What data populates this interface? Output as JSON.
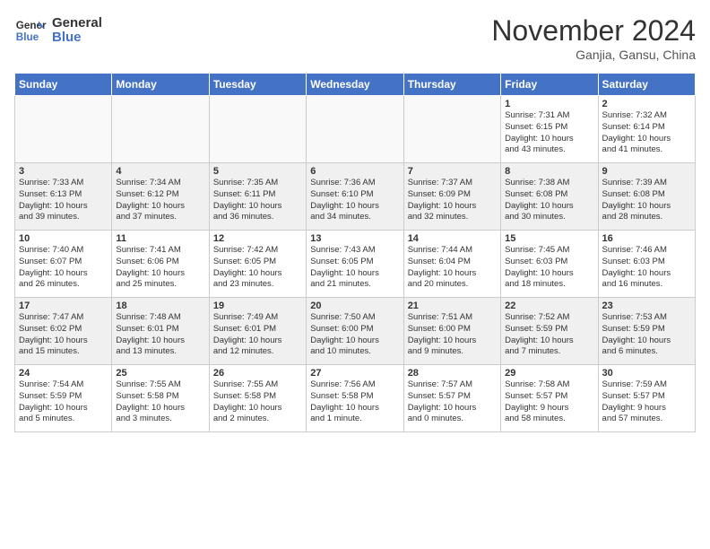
{
  "header": {
    "logo_line1": "General",
    "logo_line2": "Blue",
    "month": "November 2024",
    "location": "Ganjia, Gansu, China"
  },
  "weekdays": [
    "Sunday",
    "Monday",
    "Tuesday",
    "Wednesday",
    "Thursday",
    "Friday",
    "Saturday"
  ],
  "weeks": [
    [
      {
        "day": "",
        "info": ""
      },
      {
        "day": "",
        "info": ""
      },
      {
        "day": "",
        "info": ""
      },
      {
        "day": "",
        "info": ""
      },
      {
        "day": "",
        "info": ""
      },
      {
        "day": "1",
        "info": "Sunrise: 7:31 AM\nSunset: 6:15 PM\nDaylight: 10 hours\nand 43 minutes."
      },
      {
        "day": "2",
        "info": "Sunrise: 7:32 AM\nSunset: 6:14 PM\nDaylight: 10 hours\nand 41 minutes."
      }
    ],
    [
      {
        "day": "3",
        "info": "Sunrise: 7:33 AM\nSunset: 6:13 PM\nDaylight: 10 hours\nand 39 minutes."
      },
      {
        "day": "4",
        "info": "Sunrise: 7:34 AM\nSunset: 6:12 PM\nDaylight: 10 hours\nand 37 minutes."
      },
      {
        "day": "5",
        "info": "Sunrise: 7:35 AM\nSunset: 6:11 PM\nDaylight: 10 hours\nand 36 minutes."
      },
      {
        "day": "6",
        "info": "Sunrise: 7:36 AM\nSunset: 6:10 PM\nDaylight: 10 hours\nand 34 minutes."
      },
      {
        "day": "7",
        "info": "Sunrise: 7:37 AM\nSunset: 6:09 PM\nDaylight: 10 hours\nand 32 minutes."
      },
      {
        "day": "8",
        "info": "Sunrise: 7:38 AM\nSunset: 6:08 PM\nDaylight: 10 hours\nand 30 minutes."
      },
      {
        "day": "9",
        "info": "Sunrise: 7:39 AM\nSunset: 6:08 PM\nDaylight: 10 hours\nand 28 minutes."
      }
    ],
    [
      {
        "day": "10",
        "info": "Sunrise: 7:40 AM\nSunset: 6:07 PM\nDaylight: 10 hours\nand 26 minutes."
      },
      {
        "day": "11",
        "info": "Sunrise: 7:41 AM\nSunset: 6:06 PM\nDaylight: 10 hours\nand 25 minutes."
      },
      {
        "day": "12",
        "info": "Sunrise: 7:42 AM\nSunset: 6:05 PM\nDaylight: 10 hours\nand 23 minutes."
      },
      {
        "day": "13",
        "info": "Sunrise: 7:43 AM\nSunset: 6:05 PM\nDaylight: 10 hours\nand 21 minutes."
      },
      {
        "day": "14",
        "info": "Sunrise: 7:44 AM\nSunset: 6:04 PM\nDaylight: 10 hours\nand 20 minutes."
      },
      {
        "day": "15",
        "info": "Sunrise: 7:45 AM\nSunset: 6:03 PM\nDaylight: 10 hours\nand 18 minutes."
      },
      {
        "day": "16",
        "info": "Sunrise: 7:46 AM\nSunset: 6:03 PM\nDaylight: 10 hours\nand 16 minutes."
      }
    ],
    [
      {
        "day": "17",
        "info": "Sunrise: 7:47 AM\nSunset: 6:02 PM\nDaylight: 10 hours\nand 15 minutes."
      },
      {
        "day": "18",
        "info": "Sunrise: 7:48 AM\nSunset: 6:01 PM\nDaylight: 10 hours\nand 13 minutes."
      },
      {
        "day": "19",
        "info": "Sunrise: 7:49 AM\nSunset: 6:01 PM\nDaylight: 10 hours\nand 12 minutes."
      },
      {
        "day": "20",
        "info": "Sunrise: 7:50 AM\nSunset: 6:00 PM\nDaylight: 10 hours\nand 10 minutes."
      },
      {
        "day": "21",
        "info": "Sunrise: 7:51 AM\nSunset: 6:00 PM\nDaylight: 10 hours\nand 9 minutes."
      },
      {
        "day": "22",
        "info": "Sunrise: 7:52 AM\nSunset: 5:59 PM\nDaylight: 10 hours\nand 7 minutes."
      },
      {
        "day": "23",
        "info": "Sunrise: 7:53 AM\nSunset: 5:59 PM\nDaylight: 10 hours\nand 6 minutes."
      }
    ],
    [
      {
        "day": "24",
        "info": "Sunrise: 7:54 AM\nSunset: 5:59 PM\nDaylight: 10 hours\nand 5 minutes."
      },
      {
        "day": "25",
        "info": "Sunrise: 7:55 AM\nSunset: 5:58 PM\nDaylight: 10 hours\nand 3 minutes."
      },
      {
        "day": "26",
        "info": "Sunrise: 7:55 AM\nSunset: 5:58 PM\nDaylight: 10 hours\nand 2 minutes."
      },
      {
        "day": "27",
        "info": "Sunrise: 7:56 AM\nSunset: 5:58 PM\nDaylight: 10 hours\nand 1 minute."
      },
      {
        "day": "28",
        "info": "Sunrise: 7:57 AM\nSunset: 5:57 PM\nDaylight: 10 hours\nand 0 minutes."
      },
      {
        "day": "29",
        "info": "Sunrise: 7:58 AM\nSunset: 5:57 PM\nDaylight: 9 hours\nand 58 minutes."
      },
      {
        "day": "30",
        "info": "Sunrise: 7:59 AM\nSunset: 5:57 PM\nDaylight: 9 hours\nand 57 minutes."
      }
    ]
  ]
}
